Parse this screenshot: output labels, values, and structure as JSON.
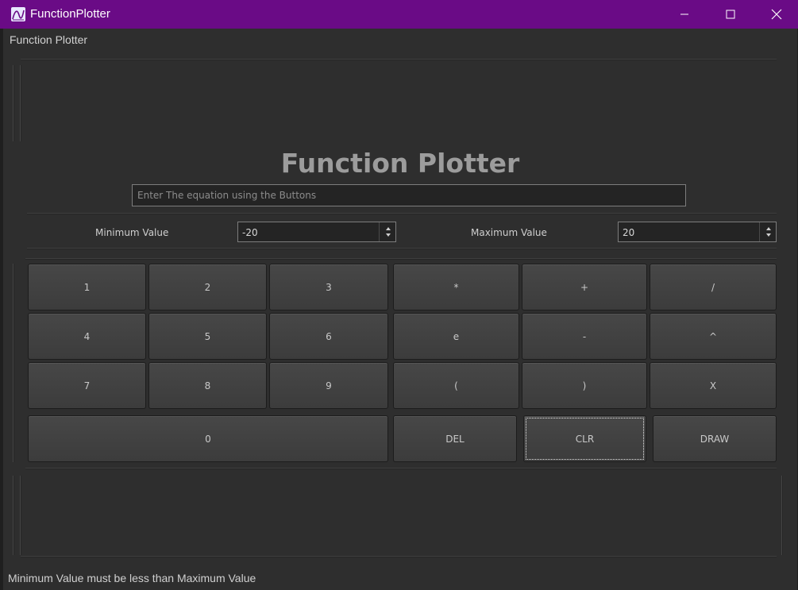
{
  "window": {
    "title": "FunctionPlotter"
  },
  "menu": {
    "label": "Function Plotter"
  },
  "main": {
    "heading": "Function Plotter",
    "equation_placeholder": "Enter The equation using the Buttons",
    "min_label": "Minimum Value",
    "min_value": "-20",
    "max_label": "Maximum Value",
    "max_value": "20"
  },
  "keypad": {
    "k1": "1",
    "k2": "2",
    "k3": "3",
    "k4": "4",
    "k5": "5",
    "k6": "6",
    "k7": "7",
    "k8": "8",
    "k9": "9",
    "k0": "0",
    "mul": "*",
    "add": "+",
    "div": "/",
    "e": "e",
    "sub": "-",
    "pow": "^",
    "lparen": "(",
    "rparen": ")",
    "x": "X",
    "del": "DEL",
    "clr": "CLR",
    "draw": "DRAW"
  },
  "status": {
    "message": "Minimum Value must be less than Maximum Value"
  },
  "colors": {
    "titlebar": "#6a0b86",
    "background": "#2e2e2e",
    "heading": "#9c9c9c"
  }
}
